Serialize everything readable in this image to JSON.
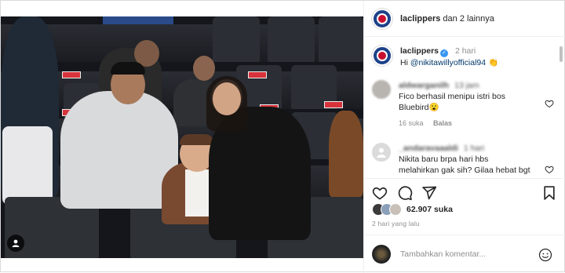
{
  "header": {
    "username": "laclippers",
    "connector": "dan 2 lainnya"
  },
  "caption": {
    "username": "laclippers",
    "verified_icon": "verified-badge-icon",
    "time": "2 hari",
    "text_prefix": "Hi ",
    "mention": "@nikitawillyofficial94",
    "emoji": "👏"
  },
  "comments": [
    {
      "username": "aldwarganilh",
      "time": "13 jam",
      "text": "Fico berhasil menipu istri bos Bluebird😮",
      "likes": "16 suka",
      "reply_label": "Balas"
    },
    {
      "username": "_andaravaaaldi",
      "time": "1 hari",
      "text": "Nikita baru brpa hari hbs melahirkan gak sih? Gilaa hebat bgt udah bisa",
      "likes": "",
      "reply_label": ""
    }
  ],
  "likes": {
    "count_text": "62.907 suka"
  },
  "date": "2 hari yang lalu",
  "add_comment": {
    "placeholder": "Tambahkan komentar..."
  },
  "icons": {
    "heart": "heart-icon",
    "comment": "comment-icon",
    "share": "share-icon",
    "save": "bookmark-icon",
    "emoji": "emoji-icon",
    "user_tag": "user-tag-icon"
  },
  "colors": {
    "verified": "#3897f0",
    "link": "#00376b",
    "muted": "#8e8e8e",
    "clippers_blue": "#1d428a",
    "clippers_red": "#c8102e"
  }
}
